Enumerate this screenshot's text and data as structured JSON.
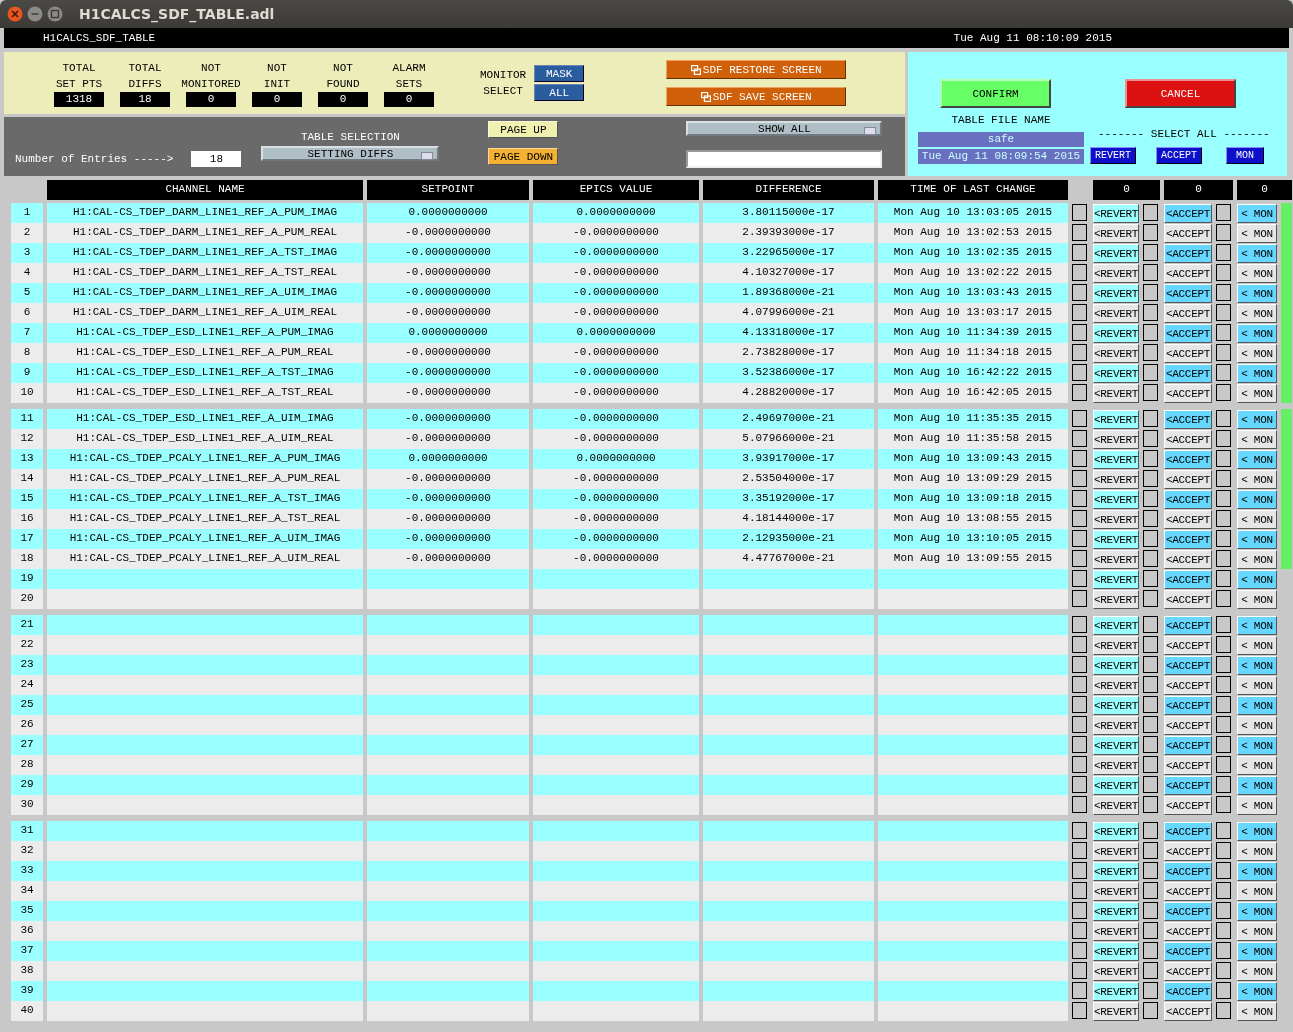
{
  "window": {
    "title": "H1CALCS_SDF_TABLE.adl"
  },
  "header": {
    "name": "H1CALCS_SDF_TABLE",
    "time": "Tue Aug 11 08:10:09 2015"
  },
  "stats": [
    {
      "label": "TOTAL\nSET PTS",
      "value": "1318"
    },
    {
      "label": "TOTAL\nDIFFS",
      "value": "18"
    },
    {
      "label": "NOT\nMONITORED",
      "value": "0"
    },
    {
      "label": "NOT\nINIT",
      "value": "0"
    },
    {
      "label": "NOT\nFOUND",
      "value": "0"
    },
    {
      "label": "ALARM\nSETS",
      "value": "0"
    }
  ],
  "monitor_select": {
    "label": "MONITOR\nSELECT",
    "buttons": [
      "MASK",
      "ALL"
    ]
  },
  "screen_buttons": [
    "SDF RESTORE SCREEN",
    "SDF SAVE SCREEN"
  ],
  "entries": {
    "label": "Number of Entries ----->",
    "value": "18"
  },
  "table_selection": {
    "label": "TABLE SELECTION",
    "value": "SETTING DIFFS"
  },
  "page_buttons": [
    "PAGE UP",
    "PAGE DOWN"
  ],
  "show_filter": {
    "value": "SHOW ALL"
  },
  "confirm": "CONFIRM",
  "cancel": "CANCEL",
  "table_file": {
    "label": "TABLE FILE NAME",
    "name": "safe",
    "time": "Tue Aug 11 08:09:54 2015"
  },
  "select_all": {
    "label": "------- SELECT ALL -------",
    "buttons": [
      "REVERT",
      "ACCEPT",
      "MON"
    ]
  },
  "columns": [
    "CHANNEL NAME",
    "SETPOINT",
    "EPICS VALUE",
    "DIFFERENCE",
    "TIME OF LAST CHANGE",
    "0",
    "0",
    "0"
  ],
  "groups": [
    {
      "rows": [
        {
          "n": "1",
          "channel": "H1:CAL-CS_TDEP_DARM_LINE1_REF_A_PUM_IMAG",
          "setpoint": "0.0000000000",
          "epics": "0.0000000000",
          "diff": "3.80115000e-17",
          "time": "Mon Aug 10 13:03:05 2015",
          "ok": true,
          "controls": [
            {
              "label": "<REVERT",
              "checked": false
            },
            {
              "label": "<ACCEPT",
              "checked": false
            },
            {
              "label": "< MON",
              "checked": false
            }
          ]
        },
        {
          "n": "2",
          "channel": "H1:CAL-CS_TDEP_DARM_LINE1_REF_A_PUM_REAL",
          "setpoint": "-0.0000000000",
          "epics": "-0.0000000000",
          "diff": "2.39393000e-17",
          "time": "Mon Aug 10 13:02:53 2015",
          "ok": true,
          "controls": [
            {
              "label": "<REVERT",
              "checked": false
            },
            {
              "label": "<ACCEPT",
              "checked": false
            },
            {
              "label": "< MON",
              "checked": false
            }
          ]
        },
        {
          "n": "3",
          "channel": "H1:CAL-CS_TDEP_DARM_LINE1_REF_A_TST_IMAG",
          "setpoint": "-0.0000000000",
          "epics": "-0.0000000000",
          "diff": "3.22965000e-17",
          "time": "Mon Aug 10 13:02:35 2015",
          "ok": true,
          "controls": [
            {
              "label": "<REVERT",
              "checked": false
            },
            {
              "label": "<ACCEPT",
              "checked": false
            },
            {
              "label": "< MON",
              "checked": false
            }
          ]
        },
        {
          "n": "4",
          "channel": "H1:CAL-CS_TDEP_DARM_LINE1_REF_A_TST_REAL",
          "setpoint": "-0.0000000000",
          "epics": "-0.0000000000",
          "diff": "4.10327000e-17",
          "time": "Mon Aug 10 13:02:22 2015",
          "ok": true,
          "controls": [
            {
              "label": "<REVERT",
              "checked": false
            },
            {
              "label": "<ACCEPT",
              "checked": false
            },
            {
              "label": "< MON",
              "checked": false
            }
          ]
        },
        {
          "n": "5",
          "channel": "H1:CAL-CS_TDEP_DARM_LINE1_REF_A_UIM_IMAG",
          "setpoint": "-0.0000000000",
          "epics": "-0.0000000000",
          "diff": "1.89368000e-21",
          "time": "Mon Aug 10 13:03:43 2015",
          "ok": true,
          "controls": [
            {
              "label": "<REVERT",
              "checked": false
            },
            {
              "label": "<ACCEPT",
              "checked": false
            },
            {
              "label": "< MON",
              "checked": false
            }
          ]
        },
        {
          "n": "6",
          "channel": "H1:CAL-CS_TDEP_DARM_LINE1_REF_A_UIM_REAL",
          "setpoint": "-0.0000000000",
          "epics": "-0.0000000000",
          "diff": "4.07996000e-21",
          "time": "Mon Aug 10 13:03:17 2015",
          "ok": true,
          "controls": [
            {
              "label": "<REVERT",
              "checked": false
            },
            {
              "label": "<ACCEPT",
              "checked": false
            },
            {
              "label": "< MON",
              "checked": false
            }
          ]
        },
        {
          "n": "7",
          "channel": "H1:CAL-CS_TDEP_ESD_LINE1_REF_A_PUM_IMAG",
          "setpoint": "0.0000000000",
          "epics": "0.0000000000",
          "diff": "4.13318000e-17",
          "time": "Mon Aug 10 11:34:39 2015",
          "ok": true,
          "controls": [
            {
              "label": "<REVERT",
              "checked": false
            },
            {
              "label": "<ACCEPT",
              "checked": false
            },
            {
              "label": "< MON",
              "checked": false
            }
          ]
        },
        {
          "n": "8",
          "channel": "H1:CAL-CS_TDEP_ESD_LINE1_REF_A_PUM_REAL",
          "setpoint": "-0.0000000000",
          "epics": "-0.0000000000",
          "diff": "2.73828000e-17",
          "time": "Mon Aug 10 11:34:18 2015",
          "ok": true,
          "controls": [
            {
              "label": "<REVERT",
              "checked": false
            },
            {
              "label": "<ACCEPT",
              "checked": false
            },
            {
              "label": "< MON",
              "checked": false
            }
          ]
        },
        {
          "n": "9",
          "channel": "H1:CAL-CS_TDEP_ESD_LINE1_REF_A_TST_IMAG",
          "setpoint": "-0.0000000000",
          "epics": "-0.0000000000",
          "diff": "3.52386000e-17",
          "time": "Mon Aug 10 16:42:22 2015",
          "ok": true,
          "controls": [
            {
              "label": "<REVERT",
              "checked": false
            },
            {
              "label": "<ACCEPT",
              "checked": false
            },
            {
              "label": "< MON",
              "checked": false
            }
          ]
        },
        {
          "n": "10",
          "channel": "H1:CAL-CS_TDEP_ESD_LINE1_REF_A_TST_REAL",
          "setpoint": "-0.0000000000",
          "epics": "-0.0000000000",
          "diff": "4.28820000e-17",
          "time": "Mon Aug 10 16:42:05 2015",
          "ok": true,
          "controls": [
            {
              "label": "<REVERT",
              "checked": false
            },
            {
              "label": "<ACCEPT",
              "checked": false
            },
            {
              "label": "< MON",
              "checked": false
            }
          ]
        }
      ]
    },
    {
      "rows": [
        {
          "n": "11",
          "channel": "H1:CAL-CS_TDEP_ESD_LINE1_REF_A_UIM_IMAG",
          "setpoint": "-0.0000000000",
          "epics": "-0.0000000000",
          "diff": "2.49697000e-21",
          "time": "Mon Aug 10 11:35:35 2015",
          "ok": true,
          "controls": [
            {
              "label": "<REVERT",
              "checked": false
            },
            {
              "label": "<ACCEPT",
              "checked": false
            },
            {
              "label": "< MON",
              "checked": false
            }
          ]
        },
        {
          "n": "12",
          "channel": "H1:CAL-CS_TDEP_ESD_LINE1_REF_A_UIM_REAL",
          "setpoint": "-0.0000000000",
          "epics": "-0.0000000000",
          "diff": "5.07966000e-21",
          "time": "Mon Aug 10 11:35:58 2015",
          "ok": true,
          "controls": [
            {
              "label": "<REVERT",
              "checked": false
            },
            {
              "label": "<ACCEPT",
              "checked": false
            },
            {
              "label": "< MON",
              "checked": false
            }
          ]
        },
        {
          "n": "13",
          "channel": "H1:CAL-CS_TDEP_PCALY_LINE1_REF_A_PUM_IMAG",
          "setpoint": "0.0000000000",
          "epics": "0.0000000000",
          "diff": "3.93917000e-17",
          "time": "Mon Aug 10 13:09:43 2015",
          "ok": true,
          "controls": [
            {
              "label": "<REVERT",
              "checked": false
            },
            {
              "label": "<ACCEPT",
              "checked": false
            },
            {
              "label": "< MON",
              "checked": false
            }
          ]
        },
        {
          "n": "14",
          "channel": "H1:CAL-CS_TDEP_PCALY_LINE1_REF_A_PUM_REAL",
          "setpoint": "-0.0000000000",
          "epics": "-0.0000000000",
          "diff": "2.53504000e-17",
          "time": "Mon Aug 10 13:09:29 2015",
          "ok": true,
          "controls": [
            {
              "label": "<REVERT",
              "checked": false
            },
            {
              "label": "<ACCEPT",
              "checked": false
            },
            {
              "label": "< MON",
              "checked": false
            }
          ]
        },
        {
          "n": "15",
          "channel": "H1:CAL-CS_TDEP_PCALY_LINE1_REF_A_TST_IMAG",
          "setpoint": "-0.0000000000",
          "epics": "-0.0000000000",
          "diff": "3.35192000e-17",
          "time": "Mon Aug 10 13:09:18 2015",
          "ok": true,
          "controls": [
            {
              "label": "<REVERT",
              "checked": false
            },
            {
              "label": "<ACCEPT",
              "checked": false
            },
            {
              "label": "< MON",
              "checked": false
            }
          ]
        },
        {
          "n": "16",
          "channel": "H1:CAL-CS_TDEP_PCALY_LINE1_REF_A_TST_REAL",
          "setpoint": "-0.0000000000",
          "epics": "-0.0000000000",
          "diff": "4.18144000e-17",
          "time": "Mon Aug 10 13:08:55 2015",
          "ok": true,
          "controls": [
            {
              "label": "<REVERT",
              "checked": false
            },
            {
              "label": "<ACCEPT",
              "checked": false
            },
            {
              "label": "< MON",
              "checked": false
            }
          ]
        },
        {
          "n": "17",
          "channel": "H1:CAL-CS_TDEP_PCALY_LINE1_REF_A_UIM_IMAG",
          "setpoint": "-0.0000000000",
          "epics": "-0.0000000000",
          "diff": "2.12935000e-21",
          "time": "Mon Aug 10 13:10:05 2015",
          "ok": true,
          "controls": [
            {
              "label": "<REVERT",
              "checked": false
            },
            {
              "label": "<ACCEPT",
              "checked": false
            },
            {
              "label": "< MON",
              "checked": false
            }
          ]
        },
        {
          "n": "18",
          "channel": "H1:CAL-CS_TDEP_PCALY_LINE1_REF_A_UIM_REAL",
          "setpoint": "-0.0000000000",
          "epics": "-0.0000000000",
          "diff": "4.47767000e-21",
          "time": "Mon Aug 10 13:09:55 2015",
          "ok": true,
          "controls": [
            {
              "label": "<REVERT",
              "checked": false
            },
            {
              "label": "<ACCEPT",
              "checked": false
            },
            {
              "label": "< MON",
              "checked": false
            }
          ]
        },
        {
          "n": "19",
          "ok": false,
          "controls": [
            {
              "label": "<REVERT",
              "checked": false
            },
            {
              "label": "<ACCEPT",
              "checked": false
            },
            {
              "label": "< MON",
              "checked": false
            }
          ]
        },
        {
          "n": "20",
          "ok": false,
          "controls": [
            {
              "label": "<REVERT",
              "checked": false
            },
            {
              "label": "<ACCEPT",
              "checked": false
            },
            {
              "label": "< MON",
              "checked": false
            }
          ]
        }
      ]
    },
    {
      "rows": [
        {
          "n": "21",
          "ok": false,
          "controls": [
            {
              "label": "<REVERT",
              "checked": false
            },
            {
              "label": "<ACCEPT",
              "checked": false
            },
            {
              "label": "< MON",
              "checked": false
            }
          ]
        },
        {
          "n": "22",
          "ok": false,
          "controls": [
            {
              "label": "<REVERT",
              "checked": false
            },
            {
              "label": "<ACCEPT",
              "checked": false
            },
            {
              "label": "< MON",
              "checked": false
            }
          ]
        },
        {
          "n": "23",
          "ok": false,
          "controls": [
            {
              "label": "<REVERT",
              "checked": false
            },
            {
              "label": "<ACCEPT",
              "checked": false
            },
            {
              "label": "< MON",
              "checked": false
            }
          ]
        },
        {
          "n": "24",
          "ok": false,
          "controls": [
            {
              "label": "<REVERT",
              "checked": false
            },
            {
              "label": "<ACCEPT",
              "checked": false
            },
            {
              "label": "< MON",
              "checked": false
            }
          ]
        },
        {
          "n": "25",
          "ok": false,
          "controls": [
            {
              "label": "<REVERT",
              "checked": false
            },
            {
              "label": "<ACCEPT",
              "checked": false
            },
            {
              "label": "< MON",
              "checked": false
            }
          ]
        },
        {
          "n": "26",
          "ok": false,
          "controls": [
            {
              "label": "<REVERT",
              "checked": false
            },
            {
              "label": "<ACCEPT",
              "checked": false
            },
            {
              "label": "< MON",
              "checked": false
            }
          ]
        },
        {
          "n": "27",
          "ok": false,
          "controls": [
            {
              "label": "<REVERT",
              "checked": false
            },
            {
              "label": "<ACCEPT",
              "checked": false
            },
            {
              "label": "< MON",
              "checked": false
            }
          ]
        },
        {
          "n": "28",
          "ok": false,
          "controls": [
            {
              "label": "<REVERT",
              "checked": false
            },
            {
              "label": "<ACCEPT",
              "checked": false
            },
            {
              "label": "< MON",
              "checked": false
            }
          ]
        },
        {
          "n": "29",
          "ok": false,
          "controls": [
            {
              "label": "<REVERT",
              "checked": false
            },
            {
              "label": "<ACCEPT",
              "checked": false
            },
            {
              "label": "< MON",
              "checked": false
            }
          ]
        },
        {
          "n": "30",
          "ok": false,
          "controls": [
            {
              "label": "<REVERT",
              "checked": false
            },
            {
              "label": "<ACCEPT",
              "checked": false
            },
            {
              "label": "< MON",
              "checked": false
            }
          ]
        }
      ]
    },
    {
      "rows": [
        {
          "n": "31",
          "ok": false,
          "controls": [
            {
              "label": "<REVERT",
              "checked": false
            },
            {
              "label": "<ACCEPT",
              "checked": false
            },
            {
              "label": "< MON",
              "checked": false
            }
          ]
        },
        {
          "n": "32",
          "ok": false,
          "controls": [
            {
              "label": "<REVERT",
              "checked": false
            },
            {
              "label": "<ACCEPT",
              "checked": false
            },
            {
              "label": "< MON",
              "checked": false
            }
          ]
        },
        {
          "n": "33",
          "ok": false,
          "controls": [
            {
              "label": "<REVERT",
              "checked": false
            },
            {
              "label": "<ACCEPT",
              "checked": false
            },
            {
              "label": "< MON",
              "checked": false
            }
          ]
        },
        {
          "n": "34",
          "ok": false,
          "controls": [
            {
              "label": "<REVERT",
              "checked": false
            },
            {
              "label": "<ACCEPT",
              "checked": false
            },
            {
              "label": "< MON",
              "checked": false
            }
          ]
        },
        {
          "n": "35",
          "ok": false,
          "controls": [
            {
              "label": "<REVERT",
              "checked": false
            },
            {
              "label": "<ACCEPT",
              "checked": false
            },
            {
              "label": "< MON",
              "checked": false
            }
          ]
        },
        {
          "n": "36",
          "ok": false,
          "controls": [
            {
              "label": "<REVERT",
              "checked": false
            },
            {
              "label": "<ACCEPT",
              "checked": false
            },
            {
              "label": "< MON",
              "checked": false
            }
          ]
        },
        {
          "n": "37",
          "ok": false,
          "controls": [
            {
              "label": "<REVERT",
              "checked": false
            },
            {
              "label": "<ACCEPT",
              "checked": false
            },
            {
              "label": "< MON",
              "checked": false
            }
          ]
        },
        {
          "n": "38",
          "ok": false,
          "controls": [
            {
              "label": "<REVERT",
              "checked": false
            },
            {
              "label": "<ACCEPT",
              "checked": false
            },
            {
              "label": "< MON",
              "checked": false
            }
          ]
        },
        {
          "n": "39",
          "ok": false,
          "controls": [
            {
              "label": "<REVERT",
              "checked": false
            },
            {
              "label": "<ACCEPT",
              "checked": false
            },
            {
              "label": "< MON",
              "checked": false
            }
          ]
        },
        {
          "n": "40",
          "ok": false,
          "controls": [
            {
              "label": "<REVERT",
              "checked": false
            },
            {
              "label": "<ACCEPT",
              "checked": false
            },
            {
              "label": "< MON",
              "checked": false
            }
          ]
        }
      ]
    }
  ]
}
